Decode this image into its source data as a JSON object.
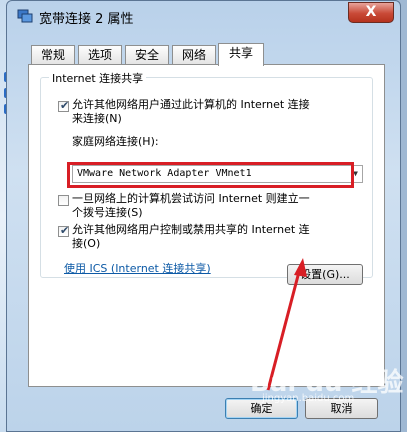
{
  "window": {
    "title": "宽带连接 2 属性",
    "close_label": "X"
  },
  "tabs": [
    {
      "label": "常规"
    },
    {
      "label": "选项"
    },
    {
      "label": "安全"
    },
    {
      "label": "网络"
    },
    {
      "label": "共享",
      "active": true
    }
  ],
  "sharing": {
    "group_title": "Internet 连接共享",
    "allow_connect": {
      "checked": true,
      "label_line1": "允许其他网络用户通过此计算机的 Internet 连接",
      "label_line2": "来连接(N)"
    },
    "home_network_label": "家庭网络连接(H):",
    "home_network_value": "VMware Network Adapter VMnet1",
    "dial_on_demand": {
      "checked": false,
      "label_line1": "一旦网络上的计算机尝试访问 Internet 则建立一",
      "label_line2": "个拨号连接(S)"
    },
    "allow_control": {
      "checked": true,
      "label_line1": "允许其他网络用户控制或禁用共享的 Internet 连",
      "label_line2": "接(O)"
    },
    "ics_link": "使用 ICS (Internet 连接共享)",
    "settings_button": "设置(G)..."
  },
  "footer": {
    "ok_button": "确定",
    "cancel_button": "取消"
  },
  "watermark": {
    "text": "Bai du 经验",
    "sub": "jingyan.baidu.com"
  },
  "colors": {
    "highlight": "#d81e25",
    "link": "#0d5aa6",
    "accent": "#2b6cc4"
  }
}
